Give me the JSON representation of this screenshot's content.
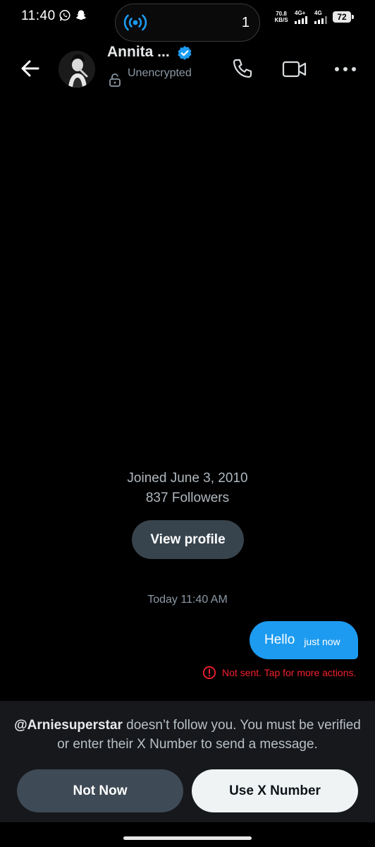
{
  "status_bar": {
    "time": "11:40",
    "app_icons": [
      "whatsapp-icon",
      "snapchat-icon"
    ],
    "island_count": "1",
    "net_speed_value": "70.8",
    "net_speed_unit": "KB/S",
    "signal_1_label": "4G+",
    "signal_2_label": "4G",
    "battery_level": "72"
  },
  "header": {
    "contact_name": "Annita ...",
    "verified": true,
    "encryption_status": "Unencrypted",
    "icons": {
      "back": "arrow-left-icon",
      "lock": "unlock-icon",
      "call": "phone-icon",
      "video": "video-camera-icon",
      "more": "more-horizontal-icon"
    }
  },
  "profile_summary": {
    "joined": "Joined June 3, 2010",
    "followers": "837 Followers",
    "view_profile_label": "View profile"
  },
  "conversation": {
    "timestamp": "Today 11:40 AM",
    "messages": [
      {
        "text": "Hello",
        "time": "just now",
        "error": "Not sent. Tap for more actions."
      }
    ]
  },
  "bottom_sheet": {
    "handle": "@Arniesuperstar",
    "message": " doesn’t follow you. You must be verified or enter their X Number to send a message.",
    "not_now_label": "Not Now",
    "use_x_number_label": "Use X Number"
  },
  "colors": {
    "background": "#000000",
    "accent_blue": "#1d9bf0",
    "error_red": "#f4212e",
    "sheet_background": "#16181c",
    "muted_text": "#8b98a5"
  }
}
